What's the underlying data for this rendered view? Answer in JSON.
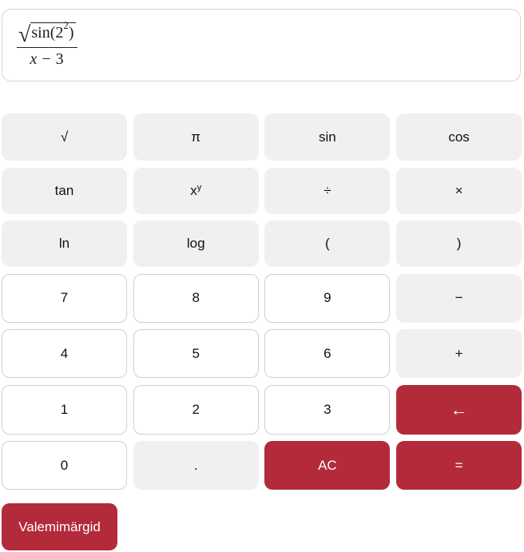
{
  "display": {
    "radicand_base": "sin(2",
    "radicand_exp": "2",
    "radicand_close": ")",
    "denominator_var": "x",
    "denominator_rest": " − 3"
  },
  "keys": {
    "sqrt": "√",
    "pi": "π",
    "sin": "sin",
    "cos": "cos",
    "tan": "tan",
    "pow_base": "x",
    "pow_exp": "y",
    "divide": "÷",
    "multiply": "×",
    "ln": "ln",
    "log": "log",
    "lparen": "(",
    "rparen": ")",
    "d7": "7",
    "d8": "8",
    "d9": "9",
    "minus": "−",
    "d4": "4",
    "d5": "5",
    "d6": "6",
    "plus": "+",
    "d1": "1",
    "d2": "2",
    "d3": "3",
    "backspace": "←",
    "d0": "0",
    "dot": ".",
    "clear": "AC",
    "equals": "="
  },
  "aux_button": "Valemimärgid",
  "colors": {
    "accent": "#b32a3a",
    "function_key_bg": "#f0f0f0",
    "digit_key_bg": "#ffffff"
  }
}
